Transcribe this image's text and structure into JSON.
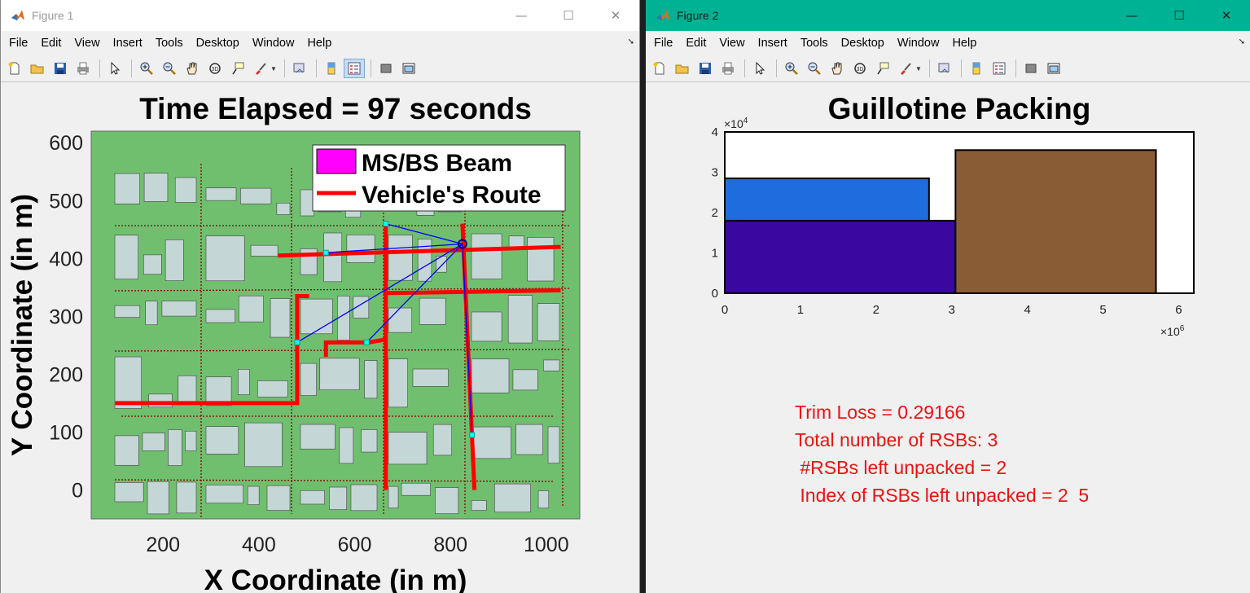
{
  "window1": {
    "title": "Figure 1",
    "menus": [
      "File",
      "Edit",
      "View",
      "Insert",
      "Tools",
      "Desktop",
      "Window",
      "Help"
    ],
    "plot": {
      "title": "Time Elapsed = 97 seconds",
      "xlabel": "X Coordinate (in m)",
      "ylabel": "Y Coordinate (in m)",
      "xticks": [
        "200",
        "400",
        "600",
        "800",
        "1000"
      ],
      "yticks": [
        "600",
        "500",
        "400",
        "300",
        "200",
        "100",
        "0"
      ],
      "legend": [
        "MS/BS Beam",
        "Vehicle's Route"
      ],
      "colors": {
        "background": "#6fbf6f",
        "building": "#c5d6d6",
        "route": "#ff0000",
        "beam": "#0000ff",
        "legend_beam": "#ff00ff"
      }
    }
  },
  "window2": {
    "title": "Figure 2",
    "menus": [
      "File",
      "Edit",
      "View",
      "Insert",
      "Tools",
      "Desktop",
      "Window",
      "Help"
    ],
    "chart_title": "Guillotine Packing",
    "y_exponent": "×10^4",
    "x_exponent": "×10^6",
    "xticks": [
      "0",
      "1",
      "2",
      "3",
      "4",
      "5",
      "6"
    ],
    "yticks": [
      "4",
      "3",
      "2",
      "1",
      "0"
    ],
    "info": {
      "trim_loss": "Trim Loss = 0.29166",
      "total": "Total number of RSBs: 3",
      "left": " #RSBs left unpacked = 2",
      "index": " Index of RSBs left unpacked = 2  5"
    }
  },
  "chart_data": [
    {
      "type": "map",
      "title": "Time Elapsed = 97 seconds",
      "xlabel": "X Coordinate (in m)",
      "ylabel": "Y Coordinate (in m)",
      "xlim": [
        50,
        1070
      ],
      "ylim": [
        -50,
        620
      ],
      "legend": [
        "MS/BS Beam",
        "Vehicle's Route"
      ],
      "legend_position": "top-right",
      "base_station": [
        825,
        425
      ],
      "beam_targets": [
        [
          665,
          460
        ],
        [
          540,
          410
        ],
        [
          480,
          255
        ],
        [
          625,
          255
        ],
        [
          845,
          95
        ]
      ],
      "routes": [
        [
          [
            665,
            465
          ],
          [
            665,
            0
          ]
        ],
        [
          [
            440,
            405
          ],
          [
            1030,
            420
          ]
        ],
        [
          [
            660,
            340
          ],
          [
            1030,
            345
          ]
        ],
        [
          [
            825,
            460
          ],
          [
            850,
            0
          ]
        ],
        [
          [
            100,
            150
          ],
          [
            480,
            150
          ],
          [
            480,
            335
          ],
          [
            505,
            335
          ]
        ],
        [
          [
            540,
            230
          ],
          [
            540,
            255
          ],
          [
            630,
            255
          ],
          [
            665,
            260
          ]
        ]
      ]
    },
    {
      "type": "bar",
      "title": "Guillotine Packing",
      "xlim": [
        0,
        6200000
      ],
      "ylim": [
        0,
        40000
      ],
      "rectangles": [
        {
          "x": 0,
          "y": 0,
          "w": 3050000,
          "h": 18000,
          "color": "#3a07a0"
        },
        {
          "x": 0,
          "y": 18000,
          "w": 2700000,
          "h": 10500,
          "color": "#1f6cde"
        },
        {
          "x": 3050000,
          "y": 0,
          "w": 2650000,
          "h": 35500,
          "color": "#8a5c36"
        }
      ]
    }
  ]
}
